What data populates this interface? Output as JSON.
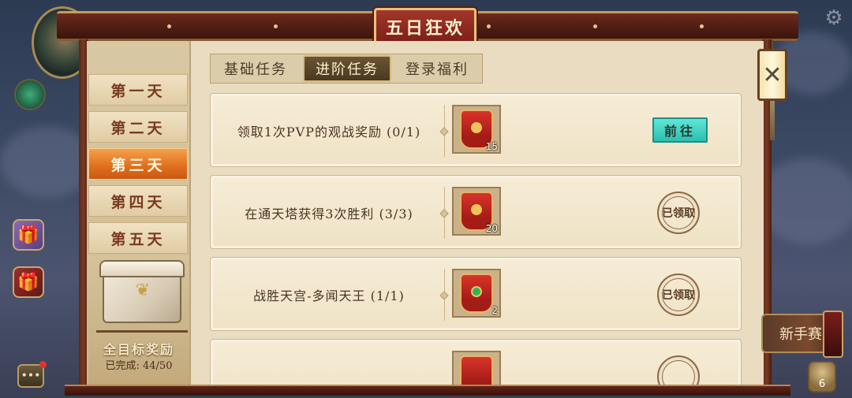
{
  "panel": {
    "title": "五日狂欢"
  },
  "day_tabs": [
    {
      "label": "第一天",
      "active": false
    },
    {
      "label": "第二天",
      "active": false
    },
    {
      "label": "第三天",
      "active": true
    },
    {
      "label": "第四天",
      "active": false
    },
    {
      "label": "第五天",
      "active": false
    }
  ],
  "chest": {
    "title": "全目标奖励",
    "progress": "已完成: 44/50"
  },
  "sub_tabs": [
    {
      "label": "基础任务",
      "active": false
    },
    {
      "label": "进阶任务",
      "active": true
    },
    {
      "label": "登录福利",
      "active": false
    }
  ],
  "tasks": [
    {
      "desc": "领取1次PVP的观战奖励 (0/1)",
      "reward_count": "15",
      "action": "前往",
      "claimed": false
    },
    {
      "desc": "在通天塔获得3次胜利 (3/3)",
      "reward_count": "20",
      "action": "已领取",
      "claimed": true
    },
    {
      "desc": "战胜天宫-多闻天王 (1/1)",
      "reward_count": "2",
      "action": "已领取",
      "claimed": true
    }
  ],
  "side": {
    "newbie_label": "新手赛",
    "currency_count": "6"
  },
  "icons": {
    "close": "close-icon",
    "gear": "gear-icon",
    "chat": "chat-icon"
  },
  "colors": {
    "active_tab": "#e06e1c",
    "go_button": "#2bbfb0",
    "title_plate": "#a2362a"
  }
}
